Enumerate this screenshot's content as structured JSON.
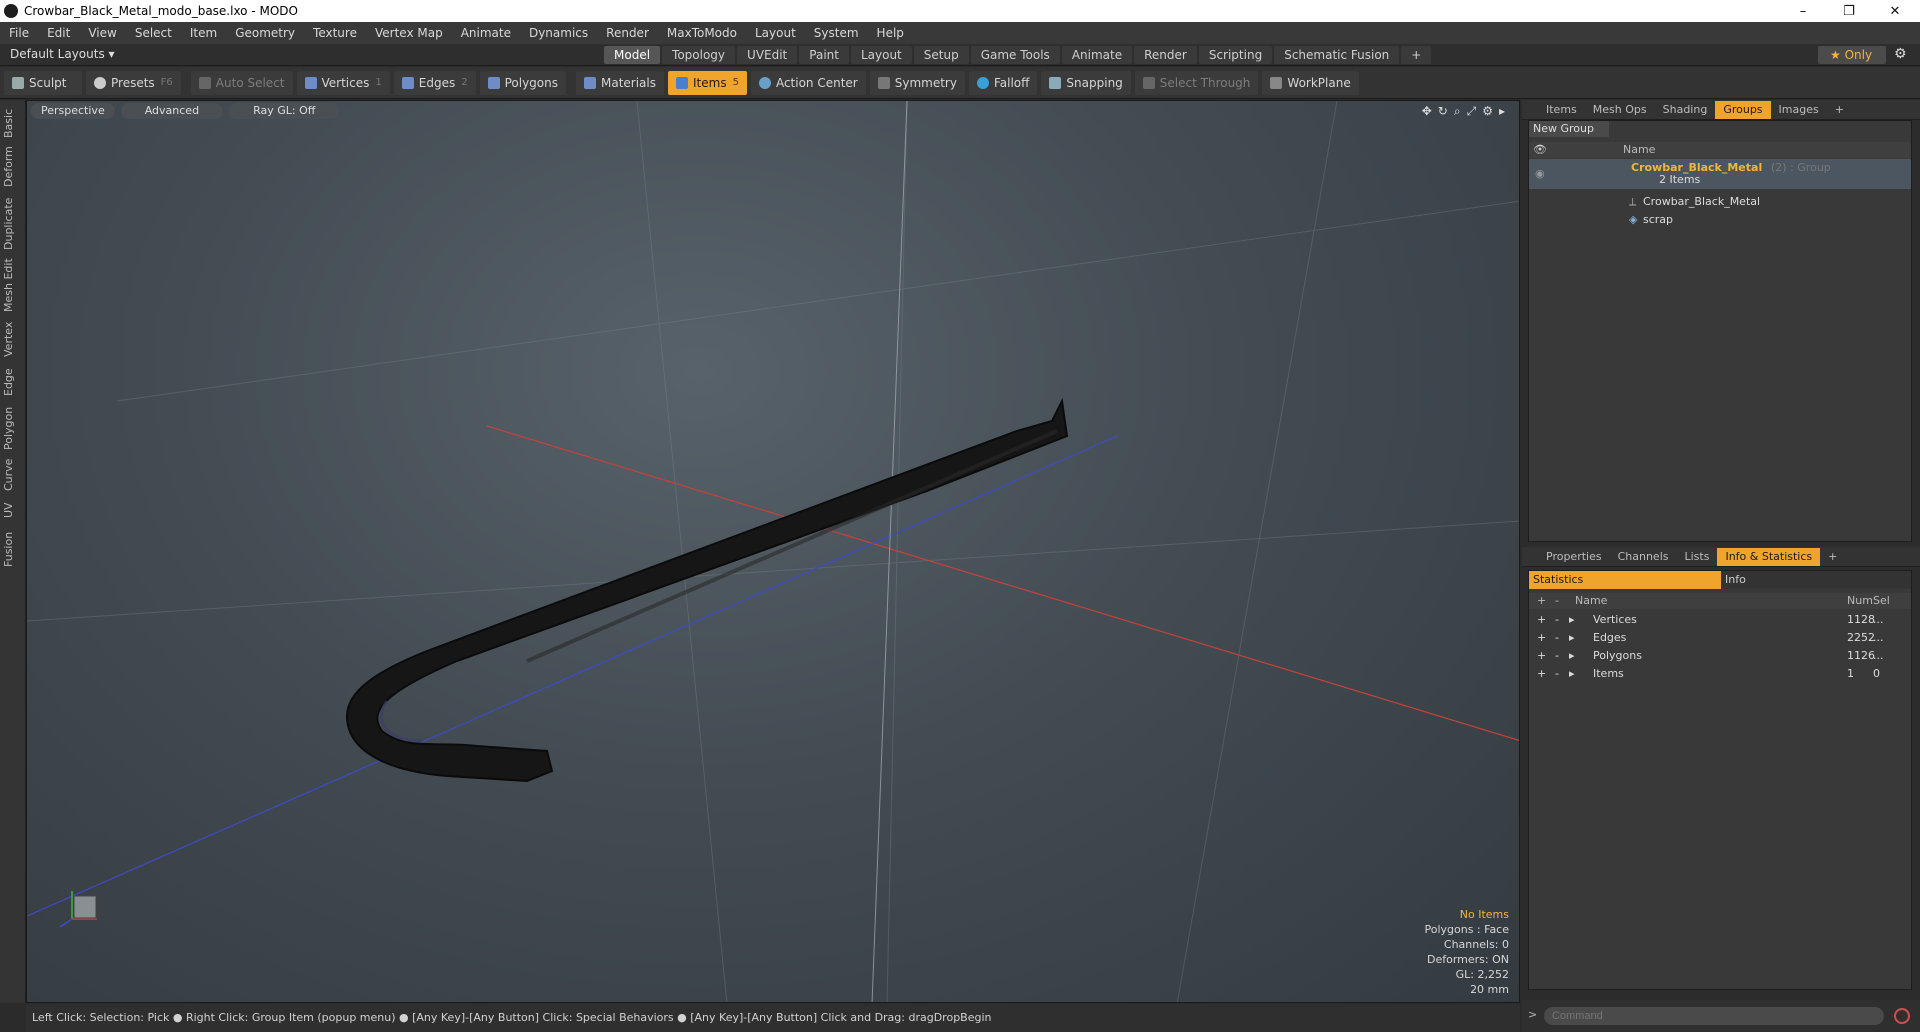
{
  "window": {
    "title": "Crowbar_Black_Metal_modo_base.lxo - MODO",
    "minimize": "–",
    "maximize": "❐",
    "close": "✕"
  },
  "menu": [
    "File",
    "Edit",
    "View",
    "Select",
    "Item",
    "Geometry",
    "Texture",
    "Vertex Map",
    "Animate",
    "Dynamics",
    "Render",
    "MaxToModo",
    "Layout",
    "System",
    "Help"
  ],
  "layout": {
    "selector": "Default Layouts ▾",
    "tabs": [
      "Model",
      "Topology",
      "UVEdit",
      "Paint",
      "Layout",
      "Setup",
      "Game Tools",
      "Animate",
      "Render",
      "Scripting",
      "Schematic Fusion"
    ],
    "active_tab": "Model",
    "only": "★  Only"
  },
  "toolbar": {
    "sculpt": "Sculpt",
    "presets": "Presets",
    "presets_key": "F6",
    "auto_select": "Auto Select",
    "vertices": "Vertices",
    "vertices_key": "1",
    "edges": "Edges",
    "edges_key": "2",
    "polygons": "Polygons",
    "materials": "Materials",
    "items": "Items",
    "items_key": "5",
    "action_center": "Action Center",
    "symmetry": "Symmetry",
    "falloff": "Falloff",
    "snapping": "Snapping",
    "select_through": "Select Through",
    "workplane": "WorkPlane"
  },
  "left_tabs": [
    "Basic",
    "Deform",
    "Duplicate",
    "Mesh Edit",
    "Vertex",
    "Edge",
    "Polygon",
    "Curve",
    "UV",
    "Fusion"
  ],
  "viewport": {
    "buttons": [
      "Perspective",
      "Advanced",
      "Ray GL: Off"
    ],
    "info": {
      "no_items": "No Items",
      "polygons": "Polygons : Face",
      "channels": "Channels: 0",
      "deformers": "Deformers: ON",
      "gl": "GL: 2,252",
      "scale": "20 mm"
    }
  },
  "status": "Left Click: Selection: Pick ● Right Click: Group Item (popup menu) ● [Any Key]-[Any Button] Click: Special Behaviors ● [Any Key]-[Any Button] Click and Drag: dragDropBegin",
  "groups_panel": {
    "tabs": [
      "Items",
      "Mesh Ops",
      "Shading",
      "Groups",
      "Images"
    ],
    "active": "Groups",
    "new_group": "New Group",
    "col_name": "Name",
    "group": {
      "name": "Crowbar_Black_Metal",
      "suffix": "(2) : Group",
      "count": "2 Items"
    },
    "children": [
      "Crowbar_Black_Metal",
      "scrap"
    ]
  },
  "info_panel": {
    "tabs": [
      "Properties",
      "Channels",
      "Lists",
      "Info & Statistics"
    ],
    "active": "Info & Statistics",
    "sub_tabs": [
      "Statistics",
      "Info"
    ],
    "columns": {
      "name": "Name",
      "num": "Num",
      "sel": "Sel"
    },
    "rows": [
      {
        "name": "Vertices",
        "num": "1128",
        "sel": "..."
      },
      {
        "name": "Edges",
        "num": "2252",
        "sel": "..."
      },
      {
        "name": "Polygons",
        "num": "1126",
        "sel": "..."
      },
      {
        "name": "Items",
        "num": "1",
        "sel": "0"
      }
    ]
  },
  "command": {
    "placeholder": "Command"
  },
  "colors": {
    "accent": "#f0a42c",
    "x_axis": "#c8413a",
    "z_axis": "#3d4bc8",
    "mesh": "#1a1a1a"
  }
}
